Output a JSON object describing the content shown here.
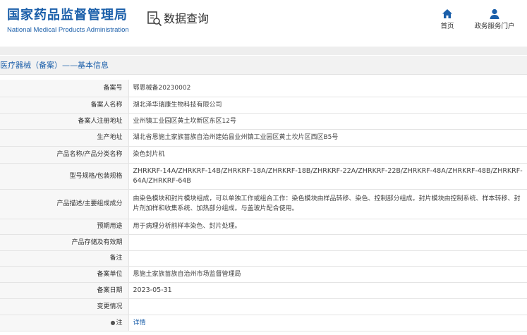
{
  "header": {
    "brand_cn": "国家药品监督管理局",
    "brand_en": "National Medical Products Administration",
    "query_label": "数据查询",
    "nav": [
      {
        "label": "首页",
        "icon": "home-icon"
      },
      {
        "label": "政务服务门户",
        "icon": "user-icon"
      }
    ]
  },
  "section": {
    "title": "医疗器械（备案）——基本信息"
  },
  "fields": [
    {
      "label": "备案号",
      "value": "鄂恩械备20230002"
    },
    {
      "label": "备案人名称",
      "value": "湖北泽华瑞康生物科技有限公司"
    },
    {
      "label": "备案人注册地址",
      "value": "业州镇工业园区黄土坎新区东区12号"
    },
    {
      "label": "生产地址",
      "value": "湖北省恩施土家族苗族自治州建始县业州镇工业园区黄土坎片区西区B5号"
    },
    {
      "label": "产品名称/产品分类名称",
      "value": "染色封片机"
    },
    {
      "label": "型号规格/包装规格",
      "value": "ZHRKRF-14A/ZHRKRF-14B/ZHRKRF-18A/ZHRKRF-18B/ZHRKRF-22A/ZHRKRF-22B/ZHRKRF-48A/ZHRKRF-48B/ZHRKRF-64A/ZHRKRF-64B"
    },
    {
      "label": "产品描述/主要组成成分",
      "value": "由染色模块和封片模块组成，可以单独工作或组合工作：染色模块由样品转移、染色、控制部分组成。封片模块由控制系统、样本转移、封片剂加样和收集系统、加热部分组成。与盖玻片配合使用。"
    },
    {
      "label": "预期用途",
      "value": "用于病理分析前样本染色、封片处理。"
    },
    {
      "label": "产品存储及有效期",
      "value": ""
    },
    {
      "label": "备注",
      "value": ""
    },
    {
      "label": "备案单位",
      "value": "恩施土家族苗族自治州市场监督管理局"
    },
    {
      "label": "备案日期",
      "value": "2023-05-31"
    },
    {
      "label": "变更情况",
      "value": ""
    },
    {
      "label": "注",
      "value": "详情",
      "tip_icon": "info-icon"
    }
  ],
  "colors": {
    "brand_blue": "#1b5faa",
    "label_bg": "#f7f7f7",
    "border": "#e4e4e4"
  }
}
